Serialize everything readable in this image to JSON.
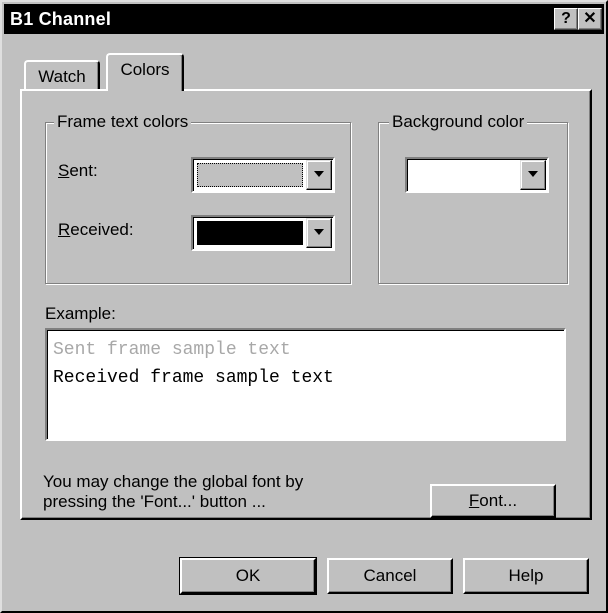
{
  "window": {
    "title": "B1 Channel",
    "help_glyph": "?",
    "close_glyph": "✕"
  },
  "tabs": [
    {
      "label": "Watch",
      "selected": false
    },
    {
      "label": "Colors",
      "selected": true
    }
  ],
  "frame_text_colors": {
    "title": "Frame text colors",
    "sent": {
      "mnemonic": "S",
      "rest": "ent:",
      "color": "#c0c0c0"
    },
    "received": {
      "mnemonic": "R",
      "rest": "eceived:",
      "color": "#000000"
    }
  },
  "background_color": {
    "title": "Background color",
    "color": "#ffffff"
  },
  "example": {
    "label": "Example:",
    "sent_text": "Sent frame sample text",
    "received_text": "Received frame sample text",
    "sent_color": "#a8a8a8"
  },
  "font_hint": {
    "line1": "You may change the global font by",
    "line2": "pressing the 'Font...' button ..."
  },
  "font_button": {
    "mnemonic": "F",
    "rest": "ont..."
  },
  "buttons": {
    "ok": "OK",
    "cancel": "Cancel",
    "help": "Help"
  }
}
